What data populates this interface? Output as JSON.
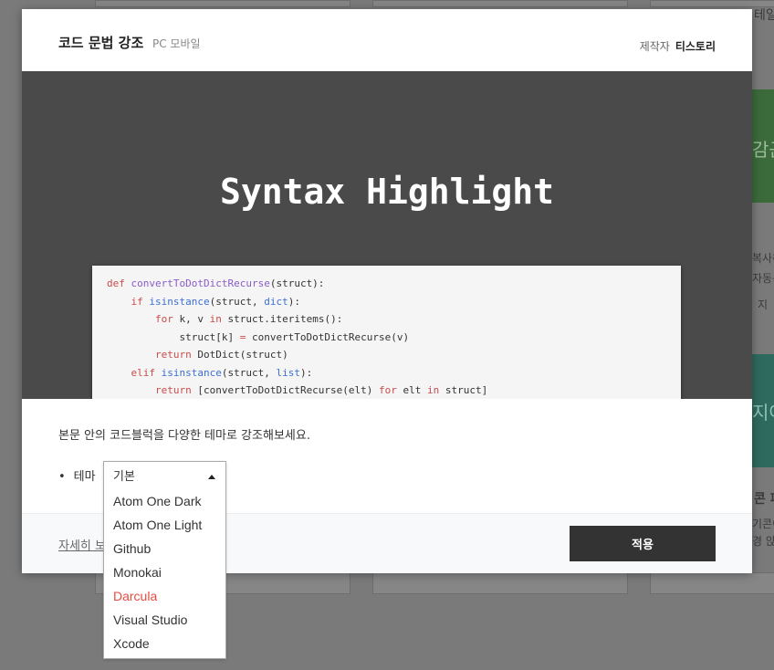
{
  "background": {
    "snippets": [
      "테일",
      "감근",
      "복사하",
      "자동복",
      "지",
      "지어",
      "콘 파",
      "기콘이",
      "경 앉"
    ]
  },
  "modal": {
    "title": "코드 문법 강조",
    "subtitle": "PC 모바일",
    "maker_label": "제작자",
    "maker_name": "티스토리",
    "preview_title": "Syntax Highlight",
    "description": "본문 안의 코드블럭을 다양한 테마로 강조해보세요.",
    "theme_bullet": "•",
    "theme_label": "테마",
    "more_link": "자세히 보",
    "apply_label": "적용"
  },
  "code_lines": [
    "def convertToDotDictRecurse(struct):",
    "    if isinstance(struct, dict):",
    "        for k, v in struct.iteritems():",
    "            struct[k] = convertToDotDictRecurse(v)",
    "        return DotDict(struct)",
    "    elif isinstance(struct, list):",
    "        return [convertToDotDictRecurse(elt) for elt in struct]"
  ],
  "theme_dropdown": {
    "selected": "기본",
    "options": [
      "Atom One Dark",
      "Atom One Light",
      "Github",
      "Monokai",
      "Darcula",
      "Visual Studio",
      "Xcode"
    ],
    "highlighted": "Darcula",
    "highlight_color": "#e84a3f"
  },
  "colors": {
    "preview_bg": "#4a4a4a",
    "apply_button_bg": "#333333",
    "keyword": "#c94c4c",
    "function_name": "#8a5cc8",
    "builtin": "#3b6fd4"
  }
}
